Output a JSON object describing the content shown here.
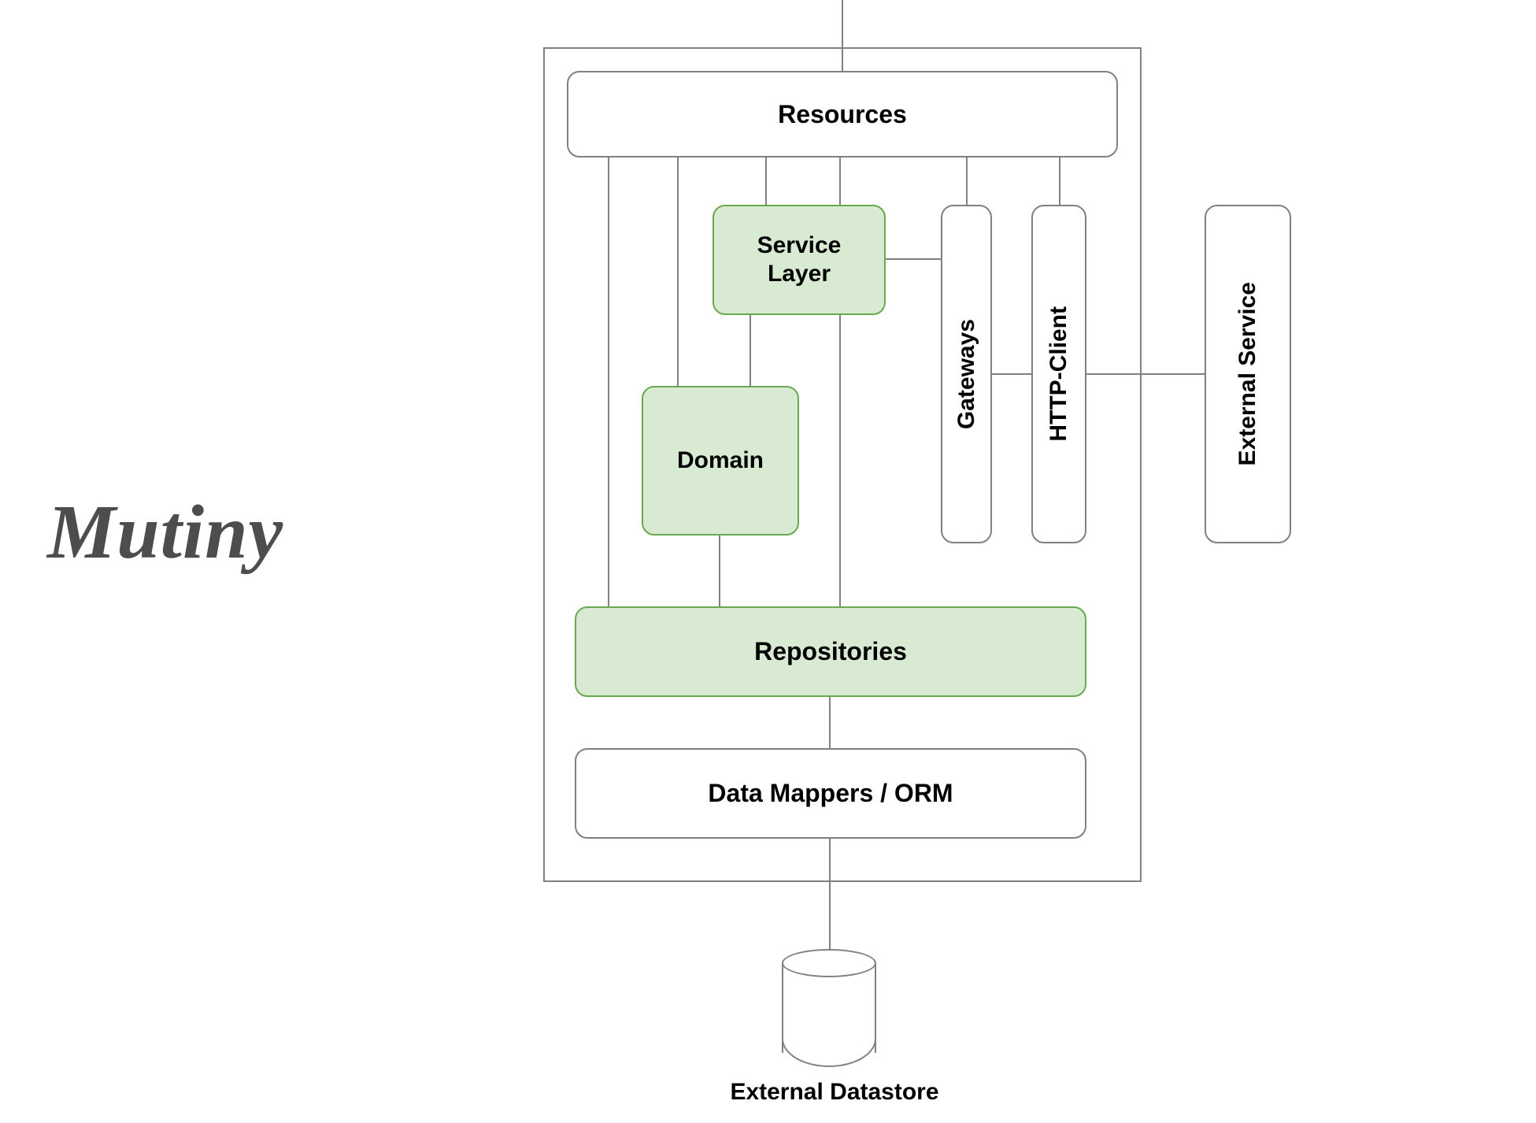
{
  "title": "Mutiny",
  "boxes": {
    "resources": "Resources",
    "service_layer": "Service\nLayer",
    "domain": "Domain",
    "gateways": "Gateways",
    "http_client": "HTTP-Client",
    "repositories": "Repositories",
    "data_mappers": "Data Mappers / ORM",
    "external_service": "External\nService"
  },
  "datastore_label": "External Datastore",
  "colors": {
    "line": "#808080",
    "green_border": "#6aa84f",
    "green_fill": "#d9ead3",
    "title": "#4d4d4d"
  }
}
